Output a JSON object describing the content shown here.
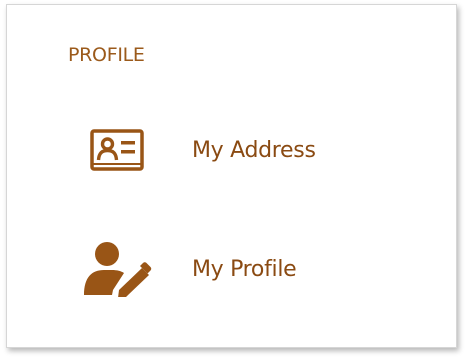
{
  "section": {
    "title": "PROFILE"
  },
  "menu": {
    "items": [
      {
        "label": "My Address",
        "icon": "address-card-icon"
      },
      {
        "label": "My Profile",
        "icon": "user-edit-icon"
      }
    ]
  },
  "colors": {
    "accent": "#9b5a1b",
    "label": "#8a4a12",
    "icon": "#995516"
  }
}
